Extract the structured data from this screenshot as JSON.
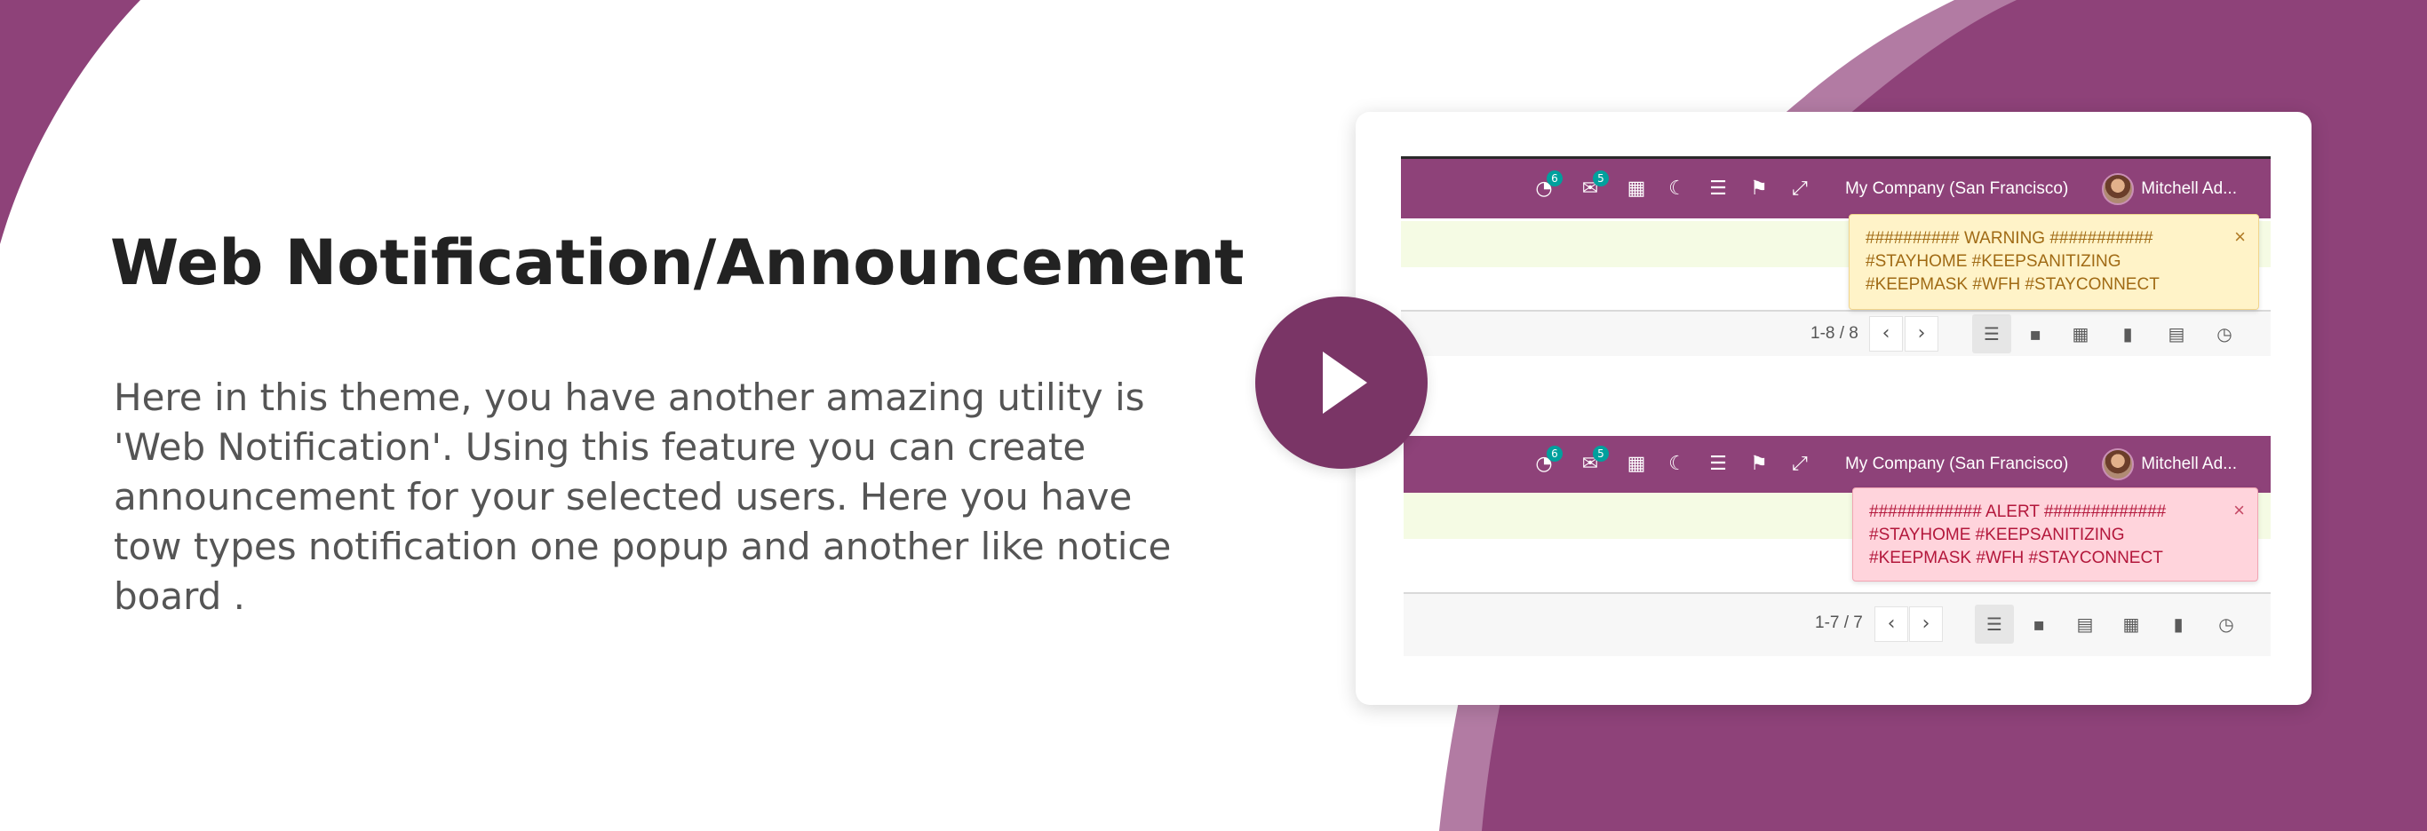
{
  "colors": {
    "brand_purple": "#8e4279",
    "play_button": "#7a3566",
    "warning_bg": "#fff3c8",
    "warning_text": "#a06a14",
    "alert_bg": "#ffd4dc",
    "alert_text": "#b3173b",
    "badge": "#00a09d"
  },
  "hero": {
    "title": "Web Notification/Announcement",
    "description": "Here in this theme, you have another amazing utility is 'Web Notification'. Using this feature you can create announcement for your selected users. Here you have tow types notification one popup and another like notice board ."
  },
  "video": {
    "play_icon": "play-icon"
  },
  "screenshots": [
    {
      "navbar": {
        "icons": [
          "activity-icon",
          "chat-icon",
          "calculator-icon",
          "moon-icon",
          "menu-icon",
          "bookmark-icon",
          "expand-icon"
        ],
        "activity_count": "6",
        "messages_count": "5",
        "company": "My Company (San Francisco)",
        "user": "Mitchell Ad..."
      },
      "pager": "1-8 / 8",
      "views": [
        "list-view-icon",
        "kanban-view-icon",
        "pivot-view-icon",
        "graph-view-icon",
        "calendar-view-icon",
        "activity-view-icon"
      ],
      "toast": {
        "type": "warning",
        "line1": "########## WARNING ###########",
        "line2": "#STAYHOME #KEEPSANITIZING",
        "line3": "#KEEPMASK #WFH #STAYCONNECT",
        "close": "×"
      }
    },
    {
      "navbar": {
        "icons": [
          "activity-icon",
          "chat-icon",
          "calculator-icon",
          "moon-icon",
          "menu-icon",
          "bookmark-icon",
          "expand-icon"
        ],
        "activity_count": "6",
        "messages_count": "5",
        "company": "My Company (San Francisco)",
        "user": "Mitchell Ad..."
      },
      "pager": "1-7 / 7",
      "views": [
        "list-view-icon",
        "kanban-view-icon",
        "calendar-view-icon",
        "pivot-view-icon",
        "graph-view-icon",
        "activity-view-icon"
      ],
      "toast": {
        "type": "alert",
        "line1": "############ ALERT #############",
        "line2": "#STAYHOME #KEEPSANITIZING",
        "line3": "#KEEPMASK #WFH #STAYCONNECT",
        "close": "×"
      }
    }
  ]
}
